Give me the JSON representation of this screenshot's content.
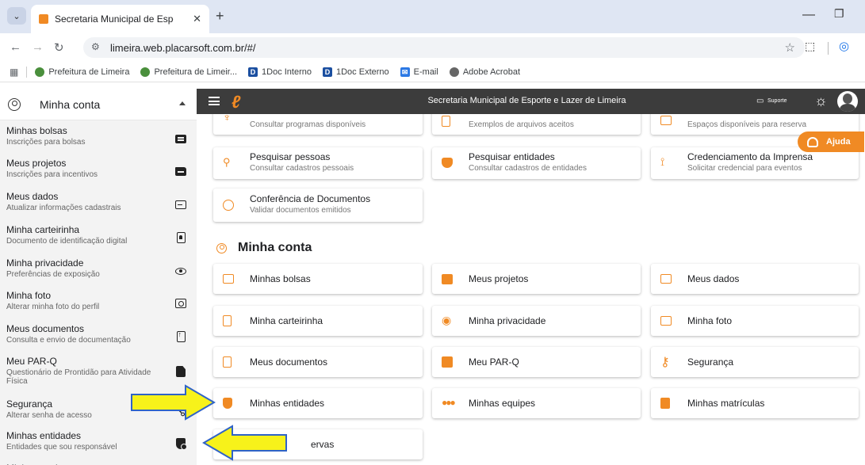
{
  "browser": {
    "tab_title": "Secretaria Municipal de Esporte",
    "tab_close": "✕",
    "new_tab": "+",
    "url": "limeira.web.placarsoft.com.br/#/",
    "bookmarks": [
      {
        "label": "Prefeitura de Limeira",
        "icon": "leaf-icon"
      },
      {
        "label": "Prefeitura de Limeir...",
        "icon": "leaf-icon"
      },
      {
        "label": "1Doc Interno",
        "icon": "doc-icon"
      },
      {
        "label": "1Doc Externo",
        "icon": "doc-icon"
      },
      {
        "label": "E-mail",
        "icon": "mail-icon"
      },
      {
        "label": "Adobe Acrobat",
        "icon": "acrobat-icon"
      }
    ]
  },
  "header": {
    "title": "Secretaria Municipal de Esporte e Lazer de Limeira",
    "support_label": "Suporte",
    "sidebar_header": "Minha conta"
  },
  "sidebar": {
    "items": [
      {
        "title": "Minhas bolsas",
        "subtitle": "Inscrições para bolsas",
        "icon": "card-icon"
      },
      {
        "title": "Meus projetos",
        "subtitle": "Inscrições para incentivos",
        "icon": "folder-icon"
      },
      {
        "title": "Meus dados",
        "subtitle": "Atualizar informações cadastrais",
        "icon": "id-card-icon"
      },
      {
        "title": "Minha carteirinha",
        "subtitle": "Documento de identificação digital",
        "icon": "badge-icon"
      },
      {
        "title": "Minha privacidade",
        "subtitle": "Preferências de exposição",
        "icon": "eye-icon"
      },
      {
        "title": "Minha foto",
        "subtitle": "Alterar minha foto do perfil",
        "icon": "camera-icon"
      },
      {
        "title": "Meus documentos",
        "subtitle": "Consulta e envio de documentação",
        "icon": "document-upload-icon"
      },
      {
        "title": "Meu PAR-Q",
        "subtitle": "Questionário de Prontidão para Atividade Física",
        "icon": "document-filled-icon"
      },
      {
        "title": "Segurança",
        "subtitle": "Alterar senha de acesso",
        "icon": "key-icon"
      },
      {
        "title": "Minhas entidades",
        "subtitle": "Entidades que sou responsável",
        "icon": "shield-icon"
      }
    ]
  },
  "main": {
    "top_cards": [
      {
        "title": "",
        "subtitle": "Consultar programas disponíveis"
      },
      {
        "title": "",
        "subtitle": "Exemplos de arquivos aceitos"
      },
      {
        "title": "",
        "subtitle": "Espaços disponíveis para reserva"
      },
      {
        "title": "Pesquisar pessoas",
        "subtitle": "Consultar cadastros pessoais"
      },
      {
        "title": "Pesquisar entidades",
        "subtitle": "Consultar cadastros de entidades"
      },
      {
        "title": "Credenciamento da Imprensa",
        "subtitle": "Solicitar credencial para eventos"
      },
      {
        "title": "Conferência de Documentos",
        "subtitle": "Validar documentos emitidos"
      }
    ],
    "section_title": "Minha conta",
    "account_cards": [
      {
        "title": "Minhas bolsas"
      },
      {
        "title": "Meus projetos"
      },
      {
        "title": "Meus dados"
      },
      {
        "title": "Minha carteirinha"
      },
      {
        "title": "Minha privacidade"
      },
      {
        "title": "Minha foto"
      },
      {
        "title": "Meus documentos"
      },
      {
        "title": "Meu PAR-Q"
      },
      {
        "title": "Segurança"
      },
      {
        "title": "Minhas entidades"
      },
      {
        "title": "Minhas equipes"
      },
      {
        "title": "Minhas matrículas"
      },
      {
        "title": "ervas"
      }
    ],
    "help_button": "Ajuda"
  },
  "colors": {
    "accent": "#f08a24",
    "topbar": "#3c3c3c",
    "sidebar_bg": "#f3f3f3",
    "arrow_fill": "#f7f21a",
    "arrow_stroke": "#2f63c7"
  }
}
